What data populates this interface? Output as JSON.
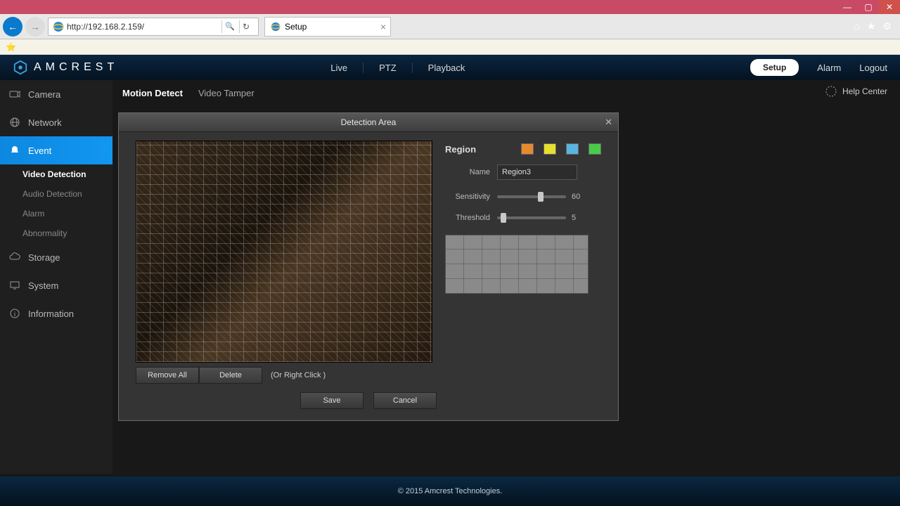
{
  "browser": {
    "url": "http://192.168.2.159/",
    "tab_title": "Setup"
  },
  "brand": "AMCREST",
  "nav": {
    "live": "Live",
    "ptz": "PTZ",
    "playback": "Playback",
    "setup": "Setup",
    "alarm": "Alarm",
    "logout": "Logout"
  },
  "sidebar": {
    "camera": "Camera",
    "network": "Network",
    "event": "Event",
    "event_subs": {
      "video_detection": "Video Detection",
      "audio_detection": "Audio Detection",
      "alarm": "Alarm",
      "abnormality": "Abnormality"
    },
    "storage": "Storage",
    "system": "System",
    "information": "Information"
  },
  "subtabs": {
    "motion_detect": "Motion Detect",
    "video_tamper": "Video Tamper"
  },
  "help_center": "Help Center",
  "dialog": {
    "title": "Detection Area",
    "region_label": "Region",
    "colors": [
      "#e68a2e",
      "#e6e02e",
      "#5ab4e0",
      "#4ac94a"
    ],
    "name_label": "Name",
    "name_value": "Region3",
    "sensitivity_label": "Sensitivity",
    "sensitivity_value": "60",
    "threshold_label": "Threshold",
    "threshold_value": "5",
    "remove_all": "Remove All",
    "delete": "Delete",
    "hint": "(Or Right Click )",
    "save": "Save",
    "cancel": "Cancel"
  },
  "footer": "© 2015 Amcrest Technologies."
}
